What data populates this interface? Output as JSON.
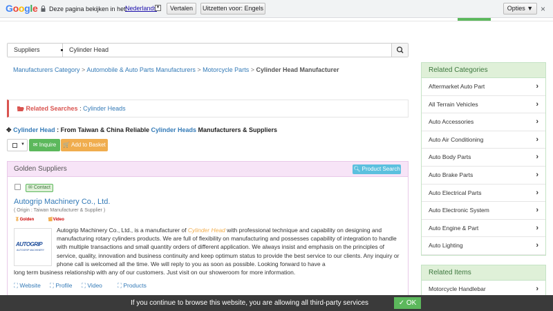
{
  "translate_bar": {
    "logo_letters": [
      {
        "ch": "G",
        "color": "#4285f4"
      },
      {
        "ch": "o",
        "color": "#ea4335"
      },
      {
        "ch": "o",
        "color": "#fbbc05"
      },
      {
        "ch": "g",
        "color": "#4285f4"
      },
      {
        "ch": "l",
        "color": "#34a853"
      },
      {
        "ch": "e",
        "color": "#ea4335"
      }
    ],
    "prompt": "Deze pagina bekijken in het:",
    "language": "Nederlands",
    "translate_button": "Vertalen",
    "disable_button": "Uitzetten voor: Engels",
    "options_button": "Opties ▼",
    "close": "×"
  },
  "search": {
    "category": "Suppliers",
    "query": "Cylinder Head"
  },
  "breadcrumb": {
    "items": [
      "Manufacturers Category",
      "Automobile & Auto Parts Manufacturers",
      "Motorcycle Parts"
    ],
    "current": "Cylinder Head Manufacturer",
    "sep": " > "
  },
  "related_searches": {
    "label": "Related Searches",
    "sep": " : ",
    "link": "Cylinder Heads"
  },
  "headline": {
    "part1": "Cylinder Head",
    "part2": " : From Taiwan & China Reliable ",
    "part3": "Cylinder Heads",
    "part4": " Manufacturers & Suppliers"
  },
  "actions": {
    "inquire": "Inquire",
    "basket": "Add to Basket"
  },
  "golden": {
    "title": "Golden Suppliers",
    "product_search": "Product Search",
    "company": {
      "contact": "Contact",
      "name": "Autogrip Machinery Co., Ltd.",
      "origin": "( Origin : Taiwan Manufacturer & Supplier )",
      "badge_golden": "Golden",
      "badge_video": "Video",
      "logo_text": "AUTOGRIP",
      "logo_sub": "AUTOGRIP MACHINERY",
      "desc_a": "Autogrip Machinery Co., Ltd., is a manufacturer of ",
      "desc_hl": "Cylinder Head",
      "desc_b": " with professional technique and capability on designing and manufacturing rotary cylinders products. We are full of flexibility on manufacturing and possesses capability of integration to handle with multiple transactions and small quantity orders of different application. We always insist and emphasis on the principles of service, quality, innovation and business continuity and keep optimum status to provide the best service to our clients. Any inquiry or phone call is welcomed all the time. We will reply to you as soon as possible. Looking forward to have a",
      "desc_c": "long term business relationship with any of our customers. Just visit on our showeroom for more information.",
      "links": [
        "Website",
        "Profile",
        "Video",
        "Products"
      ]
    }
  },
  "related_categories": {
    "title": "Related Categories",
    "items": [
      "Aftermarket Auto Part",
      "All Terrain Vehicles",
      "Auto Accessories",
      "Auto Air Conditioning",
      "Auto Body Parts",
      "Auto Brake Parts",
      "Auto Electrical Parts",
      "Auto Electronic System",
      "Auto Engine & Part",
      "Auto Lighting"
    ]
  },
  "related_items": {
    "title": "Related Items",
    "items": [
      "Motorcycle Handlebar"
    ]
  },
  "cookie": {
    "text": "If you continue to browse this website, you are allowing all third-party services",
    "ok": "✓ OK"
  },
  "colors": {
    "link": "#337ab7",
    "green": "#5cb85c",
    "orange": "#f0ad4e",
    "red": "#d9534f",
    "info": "#5bc0de"
  }
}
